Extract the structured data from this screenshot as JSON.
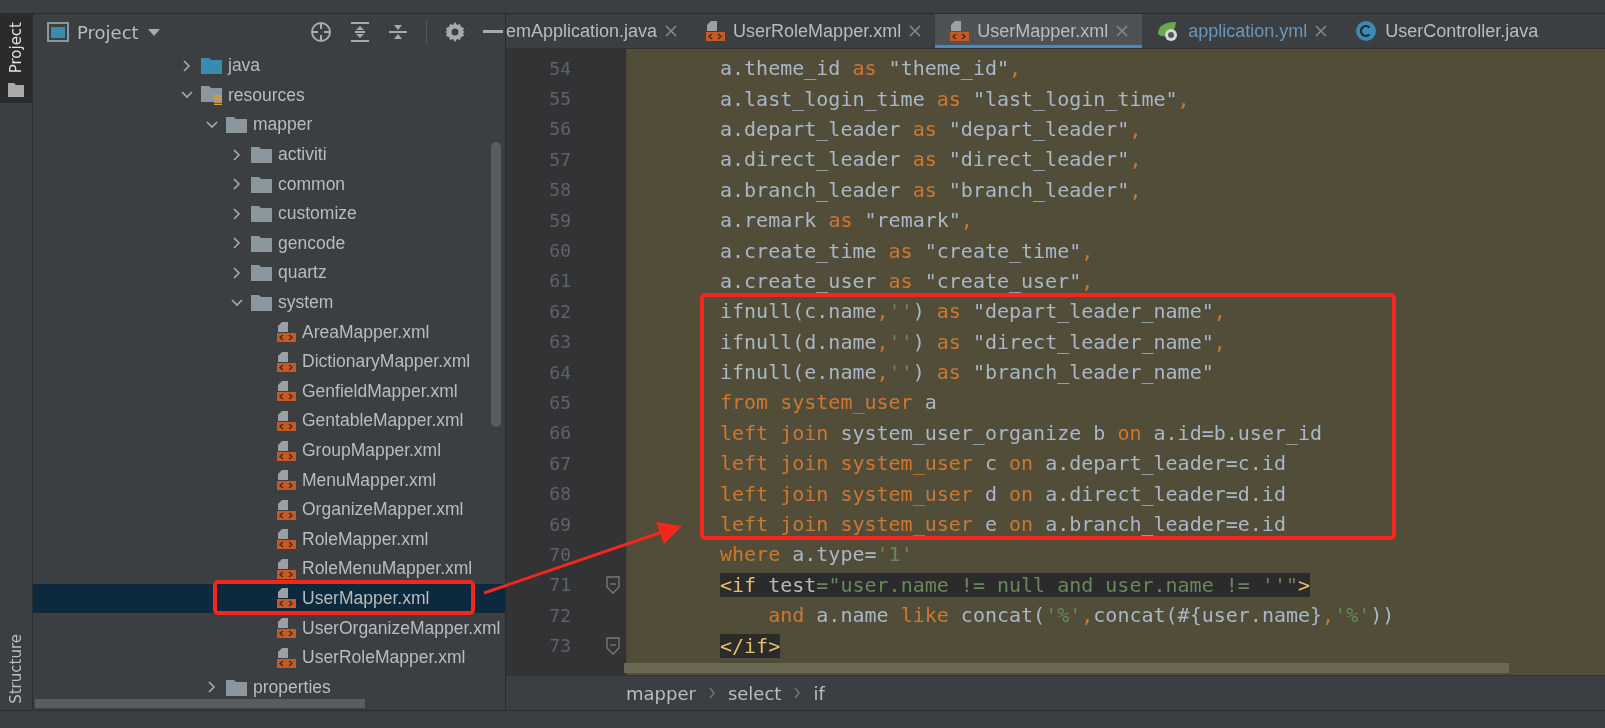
{
  "stripe": [
    {
      "label": "Project",
      "selected": true
    },
    {
      "label": "Structure",
      "selected": false
    }
  ],
  "project_panel": {
    "title": "Project",
    "tree": [
      {
        "name": "java",
        "kind": "source-folder",
        "expanded": false,
        "selected": false
      },
      {
        "name": "resources",
        "kind": "resource-folder",
        "expanded": true,
        "selected": false,
        "children": [
          {
            "name": "mapper",
            "kind": "folder",
            "expanded": true,
            "selected": false,
            "children": [
              {
                "name": "activiti",
                "kind": "folder",
                "expanded": false,
                "selected": false
              },
              {
                "name": "common",
                "kind": "folder",
                "expanded": false,
                "selected": false
              },
              {
                "name": "customize",
                "kind": "folder",
                "expanded": false,
                "selected": false
              },
              {
                "name": "gencode",
                "kind": "folder",
                "expanded": false,
                "selected": false
              },
              {
                "name": "quartz",
                "kind": "folder",
                "expanded": false,
                "selected": false
              },
              {
                "name": "system",
                "kind": "folder",
                "expanded": true,
                "selected": false,
                "children": [
                  {
                    "name": "AreaMapper.xml",
                    "kind": "xml",
                    "selected": false
                  },
                  {
                    "name": "DictionaryMapper.xml",
                    "kind": "xml",
                    "selected": false
                  },
                  {
                    "name": "GenfieldMapper.xml",
                    "kind": "xml",
                    "selected": false
                  },
                  {
                    "name": "GentableMapper.xml",
                    "kind": "xml",
                    "selected": false
                  },
                  {
                    "name": "GroupMapper.xml",
                    "kind": "xml",
                    "selected": false
                  },
                  {
                    "name": "MenuMapper.xml",
                    "kind": "xml",
                    "selected": false
                  },
                  {
                    "name": "OrganizeMapper.xml",
                    "kind": "xml",
                    "selected": false
                  },
                  {
                    "name": "RoleMapper.xml",
                    "kind": "xml",
                    "selected": false
                  },
                  {
                    "name": "RoleMenuMapper.xml",
                    "kind": "xml",
                    "selected": false
                  },
                  {
                    "name": "UserMapper.xml",
                    "kind": "xml",
                    "selected": true
                  },
                  {
                    "name": "UserOrganizeMapper.xml",
                    "kind": "xml",
                    "selected": false
                  },
                  {
                    "name": "UserRoleMapper.xml",
                    "kind": "xml",
                    "selected": false
                  }
                ]
              }
            ]
          },
          {
            "name": "properties",
            "kind": "folder",
            "expanded": false,
            "selected": false
          }
        ]
      }
    ]
  },
  "tabs": [
    {
      "label": "emApplication.java",
      "kind": "none",
      "selected": false,
      "closable": true,
      "color": "#bbbbbb"
    },
    {
      "label": "UserRoleMapper.xml",
      "kind": "xml",
      "selected": false,
      "closable": true,
      "color": "#bbbbbb"
    },
    {
      "label": "UserMapper.xml",
      "kind": "xml",
      "selected": true,
      "closable": true,
      "color": "#bbbbbb"
    },
    {
      "label": "application.yml",
      "kind": "yml",
      "selected": false,
      "closable": true,
      "color": "#6897bb"
    },
    {
      "label": "UserController.java",
      "kind": "class",
      "selected": false,
      "closable": false,
      "color": "#bbbbbb"
    }
  ],
  "editor": {
    "lines": [
      {
        "number": "54",
        "highlighted": false,
        "fold": false,
        "tokens": [
          {
            "kind": "plain",
            "text": "a.theme_id "
          },
          {
            "kind": "kw",
            "text": "as"
          },
          {
            "kind": "plain",
            "text": " \"theme_id\""
          },
          {
            "kind": "kw",
            "text": ","
          }
        ]
      },
      {
        "number": "55",
        "highlighted": false,
        "fold": false,
        "tokens": [
          {
            "kind": "plain",
            "text": "a.last_login_time "
          },
          {
            "kind": "kw",
            "text": "as"
          },
          {
            "kind": "plain",
            "text": " \"last_login_time\""
          },
          {
            "kind": "kw",
            "text": ","
          }
        ]
      },
      {
        "number": "56",
        "highlighted": false,
        "fold": false,
        "tokens": [
          {
            "kind": "plain",
            "text": "a.depart_leader "
          },
          {
            "kind": "kw",
            "text": "as"
          },
          {
            "kind": "plain",
            "text": " \"depart_leader\""
          },
          {
            "kind": "kw",
            "text": ","
          }
        ]
      },
      {
        "number": "57",
        "highlighted": false,
        "fold": false,
        "tokens": [
          {
            "kind": "plain",
            "text": "a.direct_leader "
          },
          {
            "kind": "kw",
            "text": "as"
          },
          {
            "kind": "plain",
            "text": " \"direct_leader\""
          },
          {
            "kind": "kw",
            "text": ","
          }
        ]
      },
      {
        "number": "58",
        "highlighted": false,
        "fold": false,
        "tokens": [
          {
            "kind": "plain",
            "text": "a.branch_leader "
          },
          {
            "kind": "kw",
            "text": "as"
          },
          {
            "kind": "plain",
            "text": " \"branch_leader\""
          },
          {
            "kind": "kw",
            "text": ","
          }
        ]
      },
      {
        "number": "59",
        "highlighted": false,
        "fold": false,
        "tokens": [
          {
            "kind": "plain",
            "text": "a.remark "
          },
          {
            "kind": "kw",
            "text": "as"
          },
          {
            "kind": "plain",
            "text": " \"remark\""
          },
          {
            "kind": "kw",
            "text": ","
          }
        ]
      },
      {
        "number": "60",
        "highlighted": false,
        "fold": false,
        "tokens": [
          {
            "kind": "plain",
            "text": "a.create_time "
          },
          {
            "kind": "kw",
            "text": "as"
          },
          {
            "kind": "plain",
            "text": " \"create_time\""
          },
          {
            "kind": "kw",
            "text": ","
          }
        ]
      },
      {
        "number": "61",
        "highlighted": false,
        "fold": false,
        "tokens": [
          {
            "kind": "plain",
            "text": "a.create_user "
          },
          {
            "kind": "kw",
            "text": "as"
          },
          {
            "kind": "plain",
            "text": " \"create_user\""
          },
          {
            "kind": "kw",
            "text": ","
          }
        ]
      },
      {
        "number": "62",
        "highlighted": false,
        "fold": false,
        "tokens": [
          {
            "kind": "plain",
            "text": "ifnull(c.name"
          },
          {
            "kind": "kw",
            "text": ","
          },
          {
            "kind": "str",
            "text": "''"
          },
          {
            "kind": "plain",
            "text": ") "
          },
          {
            "kind": "kw",
            "text": "as"
          },
          {
            "kind": "plain",
            "text": " \"depart_leader_name\""
          },
          {
            "kind": "kw",
            "text": ","
          }
        ]
      },
      {
        "number": "63",
        "highlighted": false,
        "fold": false,
        "tokens": [
          {
            "kind": "plain",
            "text": "ifnull(d.name"
          },
          {
            "kind": "kw",
            "text": ","
          },
          {
            "kind": "str",
            "text": "''"
          },
          {
            "kind": "plain",
            "text": ") "
          },
          {
            "kind": "kw",
            "text": "as"
          },
          {
            "kind": "plain",
            "text": " \"direct_leader_name\""
          },
          {
            "kind": "kw",
            "text": ","
          }
        ]
      },
      {
        "number": "64",
        "highlighted": false,
        "fold": false,
        "tokens": [
          {
            "kind": "plain",
            "text": "ifnull(e.name"
          },
          {
            "kind": "kw",
            "text": ","
          },
          {
            "kind": "str",
            "text": "''"
          },
          {
            "kind": "plain",
            "text": ") "
          },
          {
            "kind": "kw",
            "text": "as"
          },
          {
            "kind": "plain",
            "text": " \"branch_leader_name\""
          }
        ]
      },
      {
        "number": "65",
        "highlighted": false,
        "fold": false,
        "tokens": [
          {
            "kind": "kw",
            "text": "from system_user"
          },
          {
            "kind": "plain",
            "text": " a"
          }
        ]
      },
      {
        "number": "66",
        "highlighted": false,
        "fold": false,
        "tokens": [
          {
            "kind": "kw",
            "text": "left join "
          },
          {
            "kind": "plain",
            "text": "system_user_organize b "
          },
          {
            "kind": "kw",
            "text": "on"
          },
          {
            "kind": "plain",
            "text": " a.id=b.user_id"
          }
        ]
      },
      {
        "number": "67",
        "highlighted": false,
        "fold": false,
        "tokens": [
          {
            "kind": "kw",
            "text": "left join system_user "
          },
          {
            "kind": "plain",
            "text": "c "
          },
          {
            "kind": "kw",
            "text": "on"
          },
          {
            "kind": "plain",
            "text": " a.depart_leader=c.id"
          }
        ]
      },
      {
        "number": "68",
        "highlighted": false,
        "fold": false,
        "tokens": [
          {
            "kind": "kw",
            "text": "left join system_user "
          },
          {
            "kind": "plain",
            "text": "d "
          },
          {
            "kind": "kw",
            "text": "on"
          },
          {
            "kind": "plain",
            "text": " a.direct_leader=d.id"
          }
        ]
      },
      {
        "number": "69",
        "highlighted": false,
        "fold": false,
        "tokens": [
          {
            "kind": "kw",
            "text": "left join system_user "
          },
          {
            "kind": "plain",
            "text": "e "
          },
          {
            "kind": "kw",
            "text": "on"
          },
          {
            "kind": "plain",
            "text": " a.branch_leader=e.id"
          }
        ]
      },
      {
        "number": "70",
        "highlighted": false,
        "fold": false,
        "tokens": [
          {
            "kind": "kw",
            "text": "where "
          },
          {
            "kind": "plain",
            "text": "a.type="
          },
          {
            "kind": "str",
            "text": "'1'"
          }
        ]
      },
      {
        "number": "71",
        "highlighted": true,
        "fold": true,
        "tokens": [
          {
            "kind": "tag",
            "text": "<if "
          },
          {
            "kind": "attr",
            "text": "test"
          },
          {
            "kind": "str",
            "text": "=\"user.name != null and user.name != ''\""
          },
          {
            "kind": "tag",
            "text": ">"
          }
        ]
      },
      {
        "number": "72",
        "highlighted": false,
        "fold": false,
        "tokens": [
          {
            "kind": "kw",
            "text": "    and "
          },
          {
            "kind": "plain",
            "text": "a.name "
          },
          {
            "kind": "kw",
            "text": "like "
          },
          {
            "kind": "plain",
            "text": "concat("
          },
          {
            "kind": "str",
            "text": "'%'"
          },
          {
            "kind": "kw",
            "text": ","
          },
          {
            "kind": "plain",
            "text": "concat(#{user.name}"
          },
          {
            "kind": "kw",
            "text": ","
          },
          {
            "kind": "str",
            "text": "'%'"
          },
          {
            "kind": "plain",
            "text": "))"
          }
        ]
      },
      {
        "number": "73",
        "highlighted": true,
        "fold": true,
        "tokens": [
          {
            "kind": "tag",
            "text": "</if>"
          }
        ]
      }
    ]
  },
  "breadcrumbs": [
    "mapper",
    "select",
    "if"
  ]
}
